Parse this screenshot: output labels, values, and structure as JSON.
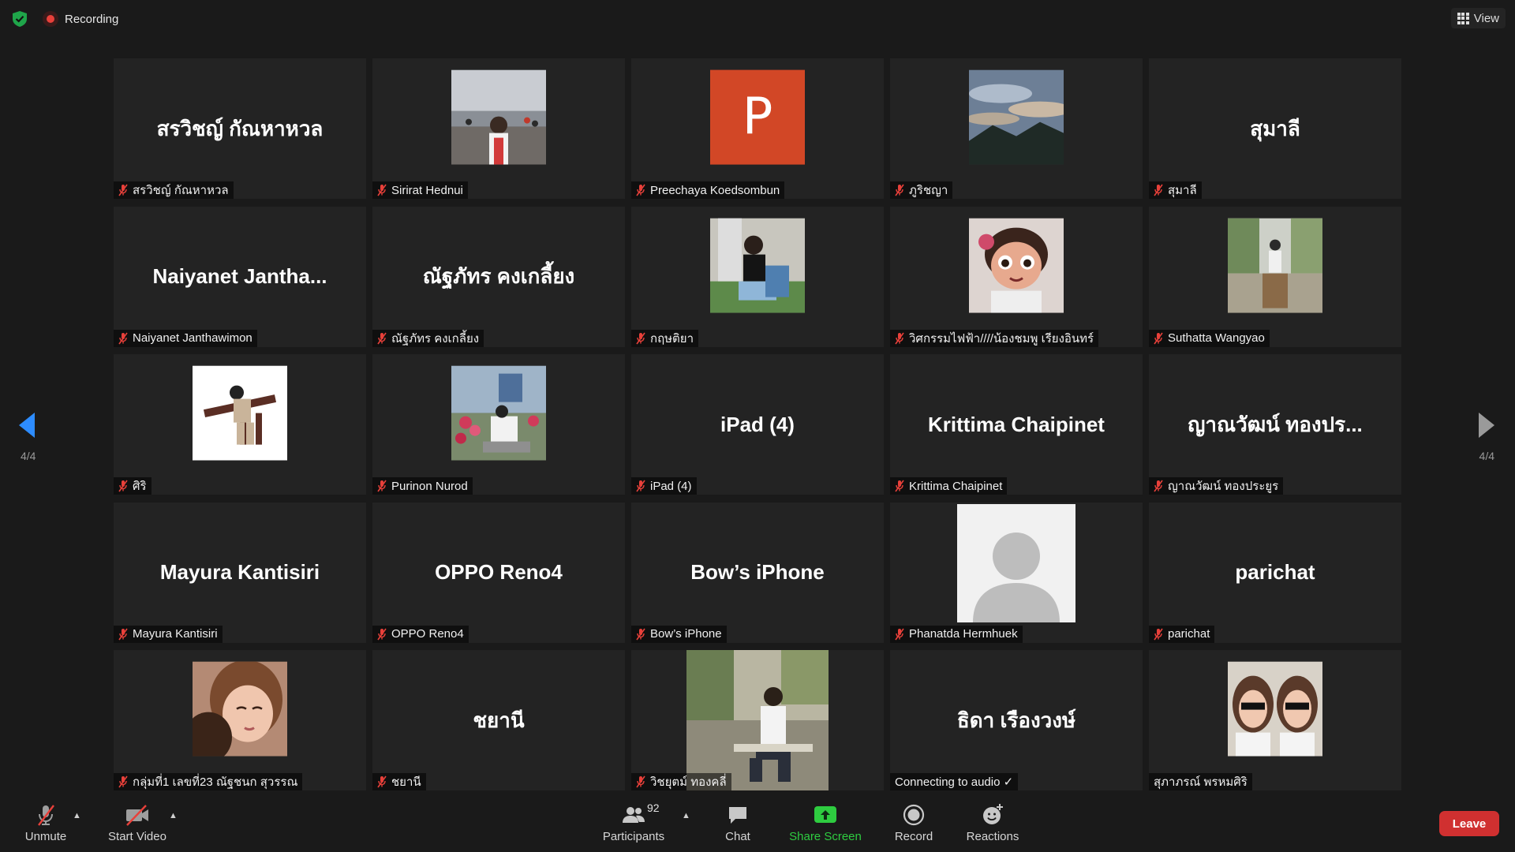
{
  "topbar": {
    "recording_label": "Recording",
    "view_label": "View",
    "colors": {
      "shield": "#1fa54a",
      "record": "#e8403a"
    }
  },
  "tiles": [
    {
      "display_name": "สรวิชญ์ กัณหาหวล",
      "label": "สรวิชญ์ กัณหาหวล",
      "type": "text"
    },
    {
      "display_name": "",
      "label": "Sirirat Hednui",
      "type": "photo",
      "avatar": "pier-photo"
    },
    {
      "display_name": "P",
      "label": "Preechaya Koedsombun",
      "type": "initial",
      "avatar_color": "#d24726"
    },
    {
      "display_name": "",
      "label": "ภูริชญา",
      "type": "photo",
      "avatar": "sky-photo"
    },
    {
      "display_name": "สุมาลี",
      "label": "สุมาลี",
      "type": "text"
    },
    {
      "display_name": "Naiyanet  Jantha...",
      "label": "Naiyanet Janthawimon",
      "type": "text"
    },
    {
      "display_name": "ณัฐภัทร คงเกลี้ยง",
      "label": "ณัฐภัทร คงเกลี้ยง",
      "type": "text"
    },
    {
      "display_name": "",
      "label": "กฤษติยา",
      "type": "photo",
      "avatar": "chair-photo"
    },
    {
      "display_name": "",
      "label": "วิศกรรมไฟฟ้า////น้องชมพู เรียงอินทร์",
      "type": "photo",
      "avatar": "cartoon-girl-photo"
    },
    {
      "display_name": "",
      "label": "Suthatta Wangyao",
      "type": "photo",
      "avatar": "park-photo"
    },
    {
      "display_name": "",
      "label": "ศิริ",
      "type": "photo",
      "avatar": "illustration"
    },
    {
      "display_name": "",
      "label": "Purinon Nurod",
      "type": "photo",
      "avatar": "flowers-photo"
    },
    {
      "display_name": "iPad (4)",
      "label": "iPad (4)",
      "type": "text"
    },
    {
      "display_name": "Krittima Chaipinet",
      "label": "Krittima Chaipinet",
      "type": "text"
    },
    {
      "display_name": "ญาณวัฒน์ ทองปร...",
      "label": "ญาณวัฒน์ ทองประยูร",
      "type": "text"
    },
    {
      "display_name": "Mayura Kantisiri",
      "label": "Mayura Kantisiri",
      "type": "text"
    },
    {
      "display_name": "OPPO Reno4",
      "label": "OPPO Reno4",
      "type": "text"
    },
    {
      "display_name": "Bow’s iPhone",
      "label": "Bow’s iPhone",
      "type": "text"
    },
    {
      "display_name": "",
      "label": "Phanatda Hermhuek",
      "type": "default-avatar"
    },
    {
      "display_name": "parichat",
      "label": "parichat",
      "type": "text"
    },
    {
      "display_name": "",
      "label": "กลุ่มที่1 เลขที่23 ณัฐชนก สุวรรณ",
      "type": "photo",
      "avatar": "selfie-photo"
    },
    {
      "display_name": "ชยานี",
      "label": "ชยานี",
      "type": "text"
    },
    {
      "display_name": "",
      "label": "วิชยุตม์ ทองคลี่",
      "type": "photo-tall",
      "avatar": "man-sitting-photo"
    },
    {
      "display_name": "ธิดา เรืองวงษ์",
      "label": "Connecting to audio ✓",
      "type": "text",
      "no_mute": true
    },
    {
      "display_name": "",
      "label": "สุภาภรณ์ พรหมศิริ",
      "type": "photo",
      "avatar": "twins-photo",
      "no_mute": true
    }
  ],
  "nav": {
    "left_page": "4/4",
    "right_page": "4/4",
    "colors": {
      "left_arrow": "#2d8cff",
      "right_arrow": "#9a9a9a"
    }
  },
  "toolbar": {
    "unmute_label": "Unmute",
    "start_video_label": "Start Video",
    "participants_label": "Participants",
    "participants_count": "92",
    "chat_label": "Chat",
    "share_screen_label": "Share Screen",
    "record_label": "Record",
    "reactions_label": "Reactions",
    "leave_label": "Leave",
    "colors": {
      "share": "#2ecc40",
      "leave": "#d03030",
      "mute_slash": "#e8403a"
    }
  }
}
